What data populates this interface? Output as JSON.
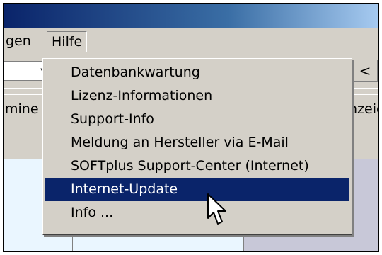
{
  "menubar": {
    "items": [
      {
        "label": "gen"
      },
      {
        "label": "Hilfe"
      }
    ]
  },
  "toolbar1": {
    "nav_button_label": "<"
  },
  "toolbar2": {
    "left_button_label": "mine a",
    "right_button_label": "nzeig"
  },
  "help_menu": {
    "items": [
      {
        "label": "Datenbankwartung",
        "highlighted": false
      },
      {
        "label": "Lizenz-Informationen",
        "highlighted": false
      },
      {
        "label": "Support-Info",
        "highlighted": false
      },
      {
        "label": "Meldung an Hersteller via E-Mail",
        "highlighted": false
      },
      {
        "label": "SOFTplus Support-Center (Internet)",
        "highlighted": false
      },
      {
        "label": "Internet-Update",
        "highlighted": true
      },
      {
        "label": "Info ...",
        "highlighted": false
      }
    ]
  },
  "icons": {
    "combo_arrow": "chevron-down-icon",
    "cursor": "mouse-pointer-icon"
  },
  "colors": {
    "highlight": "#0a246a",
    "menu_bg": "#d4d0c8",
    "grid_bg": "#eaf6ff",
    "grey_panel": "#c8c8d8"
  }
}
